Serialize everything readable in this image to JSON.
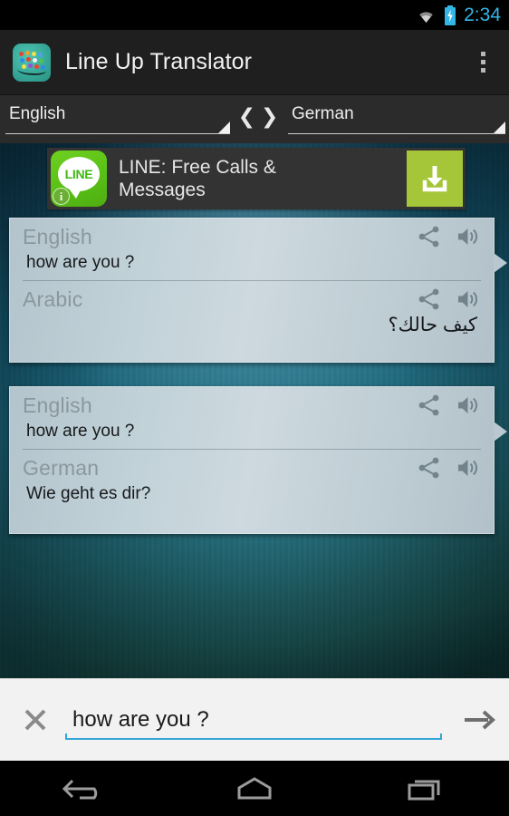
{
  "status_bar": {
    "time": "2:34",
    "wifi_icon": "wifi-icon",
    "battery_icon": "battery-charging-icon",
    "accent_color": "#33b5e5"
  },
  "action_bar": {
    "app_icon": "app-logo-icon",
    "title": "Line Up Translator",
    "overflow_icon": "overflow-menu-icon",
    "background_color": "#1f1f1f"
  },
  "language_bar": {
    "source_language": "English",
    "target_language": "German",
    "swap_left_chevron": "❮",
    "swap_right_chevron": "❯",
    "background_color": "#2b2b2b"
  },
  "ad": {
    "icon_label": "LINE",
    "info_badge": "i",
    "title": "LINE: Free Calls & Messages",
    "download_icon": "download-icon",
    "download_color": "#a5c639",
    "background_color": "#333333"
  },
  "cards": [
    {
      "source_label": "English",
      "source_text": "how are you ?",
      "source_rtl": false,
      "target_label": "Arabic",
      "target_text": "كيف حالك؟",
      "target_rtl": true,
      "share_icon": "share-icon",
      "speak_icon": "speaker-icon"
    },
    {
      "source_label": "English",
      "source_text": "how are you ?",
      "source_rtl": false,
      "target_label": "German",
      "target_text": "Wie geht es dir?",
      "target_rtl": false,
      "share_icon": "share-icon",
      "speak_icon": "speaker-icon"
    }
  ],
  "input_bar": {
    "clear_icon": "close-icon",
    "value": "how are you ?",
    "placeholder": "",
    "send_icon": "arrow-right-icon",
    "underline_color": "#33a6d6",
    "background_color": "#f2f2f2"
  },
  "nav_bar": {
    "back_icon": "back-icon",
    "home_icon": "home-icon",
    "recents_icon": "recents-icon"
  }
}
